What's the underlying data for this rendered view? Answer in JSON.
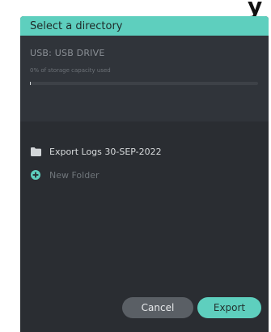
{
  "colors": {
    "accent": "#5ecfbe",
    "dialog_bg": "#2a2d32",
    "storage_bg": "#30343a",
    "cancel_bg": "#5a5f65"
  },
  "dialog": {
    "title": "Select a directory"
  },
  "storage": {
    "device_name": "USB: USB DRIVE",
    "usage_text": "0% of storage capacity used",
    "usage_fraction": 0.0
  },
  "directory_list": {
    "items": [
      {
        "label": "Export Logs 30-SEP-2022",
        "icon": "folder-icon"
      }
    ],
    "new_folder": {
      "label": "New Folder",
      "icon": "plus-circle-icon"
    }
  },
  "actions": {
    "cancel_label": "Cancel",
    "export_label": "Export"
  }
}
